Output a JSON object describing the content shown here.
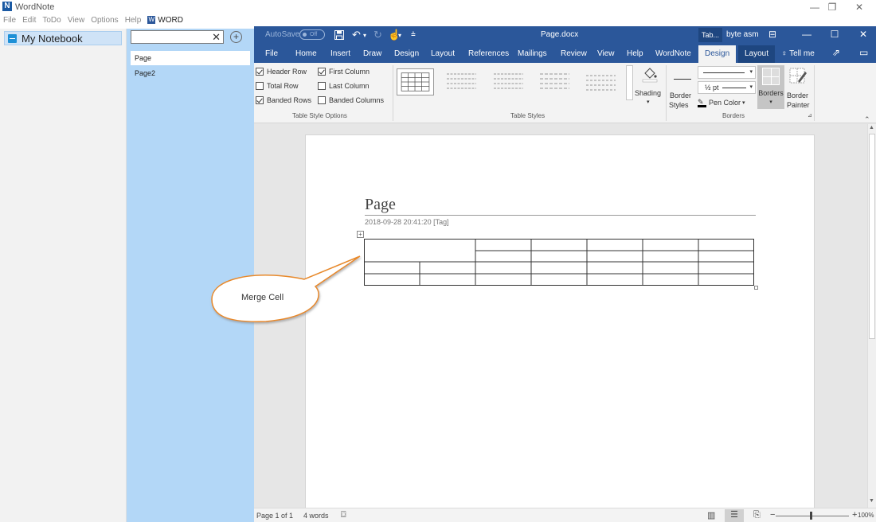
{
  "app": {
    "logo_letter": "N",
    "title": "WordNote",
    "window_controls": [
      "—",
      "❐",
      "✕"
    ]
  },
  "menu": {
    "items": [
      "File",
      "Edit",
      "ToDo",
      "View",
      "Options",
      "Help"
    ],
    "word_item": "WORD",
    "word_badge": "W"
  },
  "notebook": {
    "name": "My Notebook"
  },
  "pages": {
    "search_value": "",
    "clear_icon": "✕",
    "add_icon": "+",
    "items": [
      "Page",
      "Page2"
    ],
    "selected": "Page"
  },
  "word": {
    "autosave_label": "AutoSave",
    "autosave_state": "Off",
    "doc_title": "Page.docx",
    "tab_shortcut": "Tab...",
    "user": "byte asm",
    "window_controls": [
      "⊟",
      "—",
      "☐",
      "✕"
    ],
    "tabs": [
      "File",
      "Home",
      "Insert",
      "Draw",
      "Design",
      "Layout",
      "References",
      "Mailings",
      "Review",
      "View",
      "Help",
      "WordNote"
    ],
    "context_tabs": [
      "Design",
      "Layout"
    ],
    "tell_me": "Tell me",
    "accent_color": "#2b579a"
  },
  "ribbon": {
    "style_options": {
      "header_row": "Header Row",
      "first_column": "First Column",
      "total_row": "Total Row",
      "last_column": "Last Column",
      "banded_rows": "Banded Rows",
      "banded_columns": "Banded Columns",
      "checked": {
        "header_row": true,
        "first_column": true,
        "total_row": false,
        "last_column": false,
        "banded_rows": true,
        "banded_columns": false
      }
    },
    "group_style_options": "Table Style Options",
    "group_table_styles": "Table Styles",
    "group_borders": "Borders",
    "shading": "Shading",
    "border_styles_1": "Border",
    "border_styles_2": "Styles",
    "pen_weight": "½ pt",
    "pen_color": "Pen Color",
    "borders": "Borders",
    "border_painter_1": "Border",
    "border_painter_2": "Painter"
  },
  "document": {
    "title": "Page",
    "meta": "2018-09-28 20:41:20  [Tag]"
  },
  "callout": {
    "text": "Merge Cell"
  },
  "status": {
    "page": "Page 1 of 1",
    "words": "4 words",
    "zoom_minus": "−",
    "zoom_plus": "+",
    "zoom": "100%"
  }
}
